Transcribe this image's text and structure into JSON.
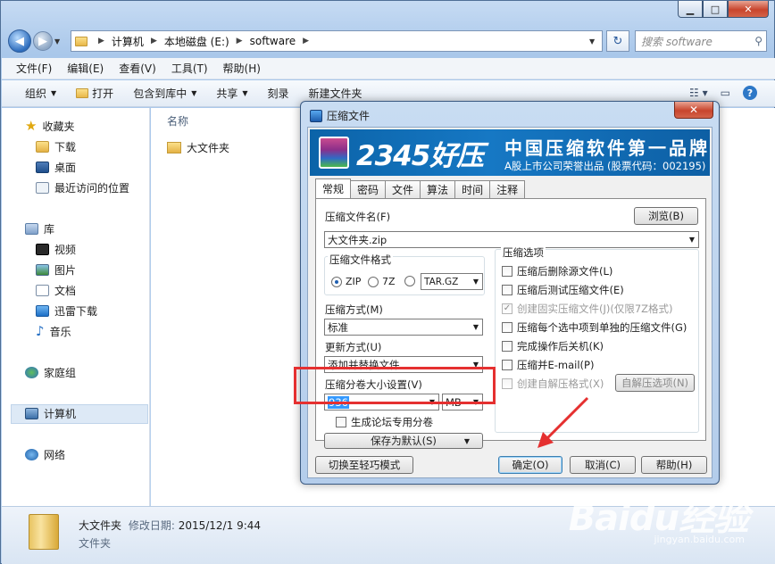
{
  "explorer": {
    "address": {
      "crumbs": [
        "计算机",
        "本地磁盘 (E:)",
        "software"
      ]
    },
    "search_placeholder": "搜索 software",
    "menu": [
      "文件(F)",
      "编辑(E)",
      "查看(V)",
      "工具(T)",
      "帮助(H)"
    ],
    "toolbar": {
      "organize": "组织",
      "open": "打开",
      "include": "包含到库中",
      "share": "共享",
      "burn": "刻录",
      "new_folder": "新建文件夹"
    },
    "sidebar": {
      "favorites": "收藏夹",
      "favorites_items": [
        "下载",
        "桌面",
        "最近访问的位置"
      ],
      "libraries": "库",
      "library_items": [
        "视频",
        "图片",
        "文档",
        "迅雷下载",
        "音乐"
      ],
      "homegroup": "家庭组",
      "computer": "计算机",
      "network": "网络"
    },
    "column_name": "名称",
    "files": [
      {
        "name": "大文件夹"
      }
    ],
    "details": {
      "name": "大文件夹",
      "modified_label": "修改日期:",
      "modified": "2015/12/1 9:44",
      "type": "文件夹"
    }
  },
  "dialog": {
    "title": "压缩文件",
    "close": "✕",
    "banner": {
      "brand": "2345好压",
      "slogan": "中国压缩软件第一品牌",
      "sub": "A股上市公司荣誉出品 (股票代码：002195)"
    },
    "tabs": [
      "常规",
      "密码",
      "文件",
      "算法",
      "时间",
      "注释"
    ],
    "filename_label": "压缩文件名(F)",
    "browse": "浏览(B)",
    "filename_value": "大文件夹.zip",
    "format_label": "压缩文件格式",
    "formats": [
      "ZIP",
      "7Z"
    ],
    "format_other": "TAR.GZ",
    "method_label": "压缩方式(M)",
    "method_value": "标准",
    "update_label": "更新方式(U)",
    "update_value": "添加并替换文件",
    "split_label": "压缩分卷大小设置(V)",
    "split_value": "936",
    "split_unit": "MB",
    "forum_split": "生成论坛专用分卷",
    "save_default": "保存为默认(S)",
    "options_label": "压缩选项",
    "options": [
      {
        "label": "压缩后删除源文件(L)",
        "checked": false,
        "disabled": false
      },
      {
        "label": "压缩后测试压缩文件(E)",
        "checked": false,
        "disabled": false
      },
      {
        "label": "创建固实压缩文件(J)(仅限7Z格式)",
        "checked": true,
        "disabled": true
      },
      {
        "label": "压缩每个选中项到单独的压缩文件(G)",
        "checked": false,
        "disabled": false
      },
      {
        "label": "完成操作后关机(K)",
        "checked": false,
        "disabled": false
      },
      {
        "label": "压缩并E-mail(P)",
        "checked": false,
        "disabled": false
      },
      {
        "label": "创建自解压格式(X)",
        "checked": false,
        "disabled": true
      }
    ],
    "sfx_options": "自解压选项(N)",
    "light_mode": "切换至轻巧模式",
    "ok": "确定(O)",
    "cancel": "取消(C)",
    "help": "帮助(H)"
  },
  "watermark": {
    "text": "Baidu经验",
    "url": "jingyan.baidu.com"
  },
  "colors": {
    "highlight": "#e53030",
    "accent": "#1678c4",
    "selection": "#3399ff"
  }
}
